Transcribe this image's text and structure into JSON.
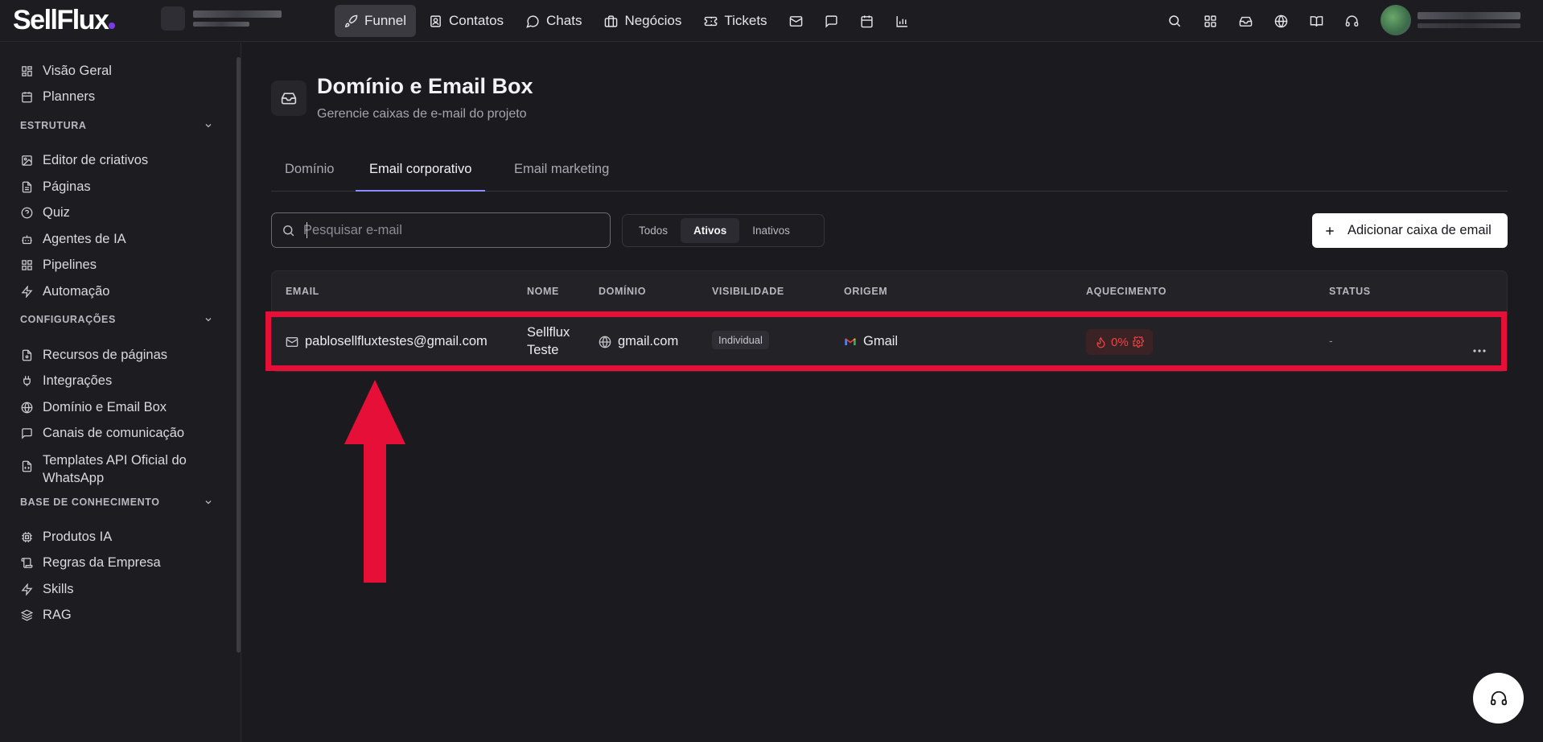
{
  "app": {
    "logo": "SellFlux"
  },
  "nav": {
    "funnel": "Funnel",
    "contatos": "Contatos",
    "chats": "Chats",
    "negocios": "Negócios",
    "tickets": "Tickets"
  },
  "sidebar": {
    "top_items": [
      "Visão Geral",
      "Planners"
    ],
    "section_estrutura": "ESTRUTURA",
    "estrutura_items": [
      "Editor de criativos",
      "Páginas",
      "Quiz",
      "Agentes de IA",
      "Pipelines",
      "Automação"
    ],
    "section_config": "CONFIGURAÇÕES",
    "config_items": [
      "Recursos de páginas",
      "Integrações",
      "Domínio e Email Box",
      "Canais de comunicação"
    ],
    "templates_line1": "Templates API Oficial do",
    "templates_line2": "WhatsApp",
    "section_base": "BASE DE CONHECIMENTO",
    "base_items": [
      "Produtos IA",
      "Regras da Empresa",
      "Skills",
      "RAG"
    ]
  },
  "page": {
    "title": "Domínio e Email Box",
    "subtitle": "Gerencie caixas de e-mail do projeto"
  },
  "tabs": [
    "Domínio",
    "Email corporativo",
    "Email marketing"
  ],
  "search": {
    "placeholder": "Pesquisar e-mail"
  },
  "filters": [
    "Todos",
    "Ativos",
    "Inativos"
  ],
  "add_button": "Adicionar caixa de email",
  "table": {
    "headers": [
      "EMAIL",
      "NOME",
      "DOMÍNIO",
      "VISIBILIDADE",
      "ORIGEM",
      "AQUECIMENTO",
      "STATUS"
    ],
    "row": {
      "email": "pablosellfluxtestes@gmail.com",
      "nome_line1": "Sellflux",
      "nome_line2": "Teste",
      "dominio": "gmail.com",
      "visibilidade": "Individual",
      "origem": "Gmail",
      "aquecimento": "0%",
      "status": "-"
    }
  },
  "colors": {
    "accent": "#8b8dff",
    "highlight": "#e60f37",
    "heat": "#ef4444"
  }
}
